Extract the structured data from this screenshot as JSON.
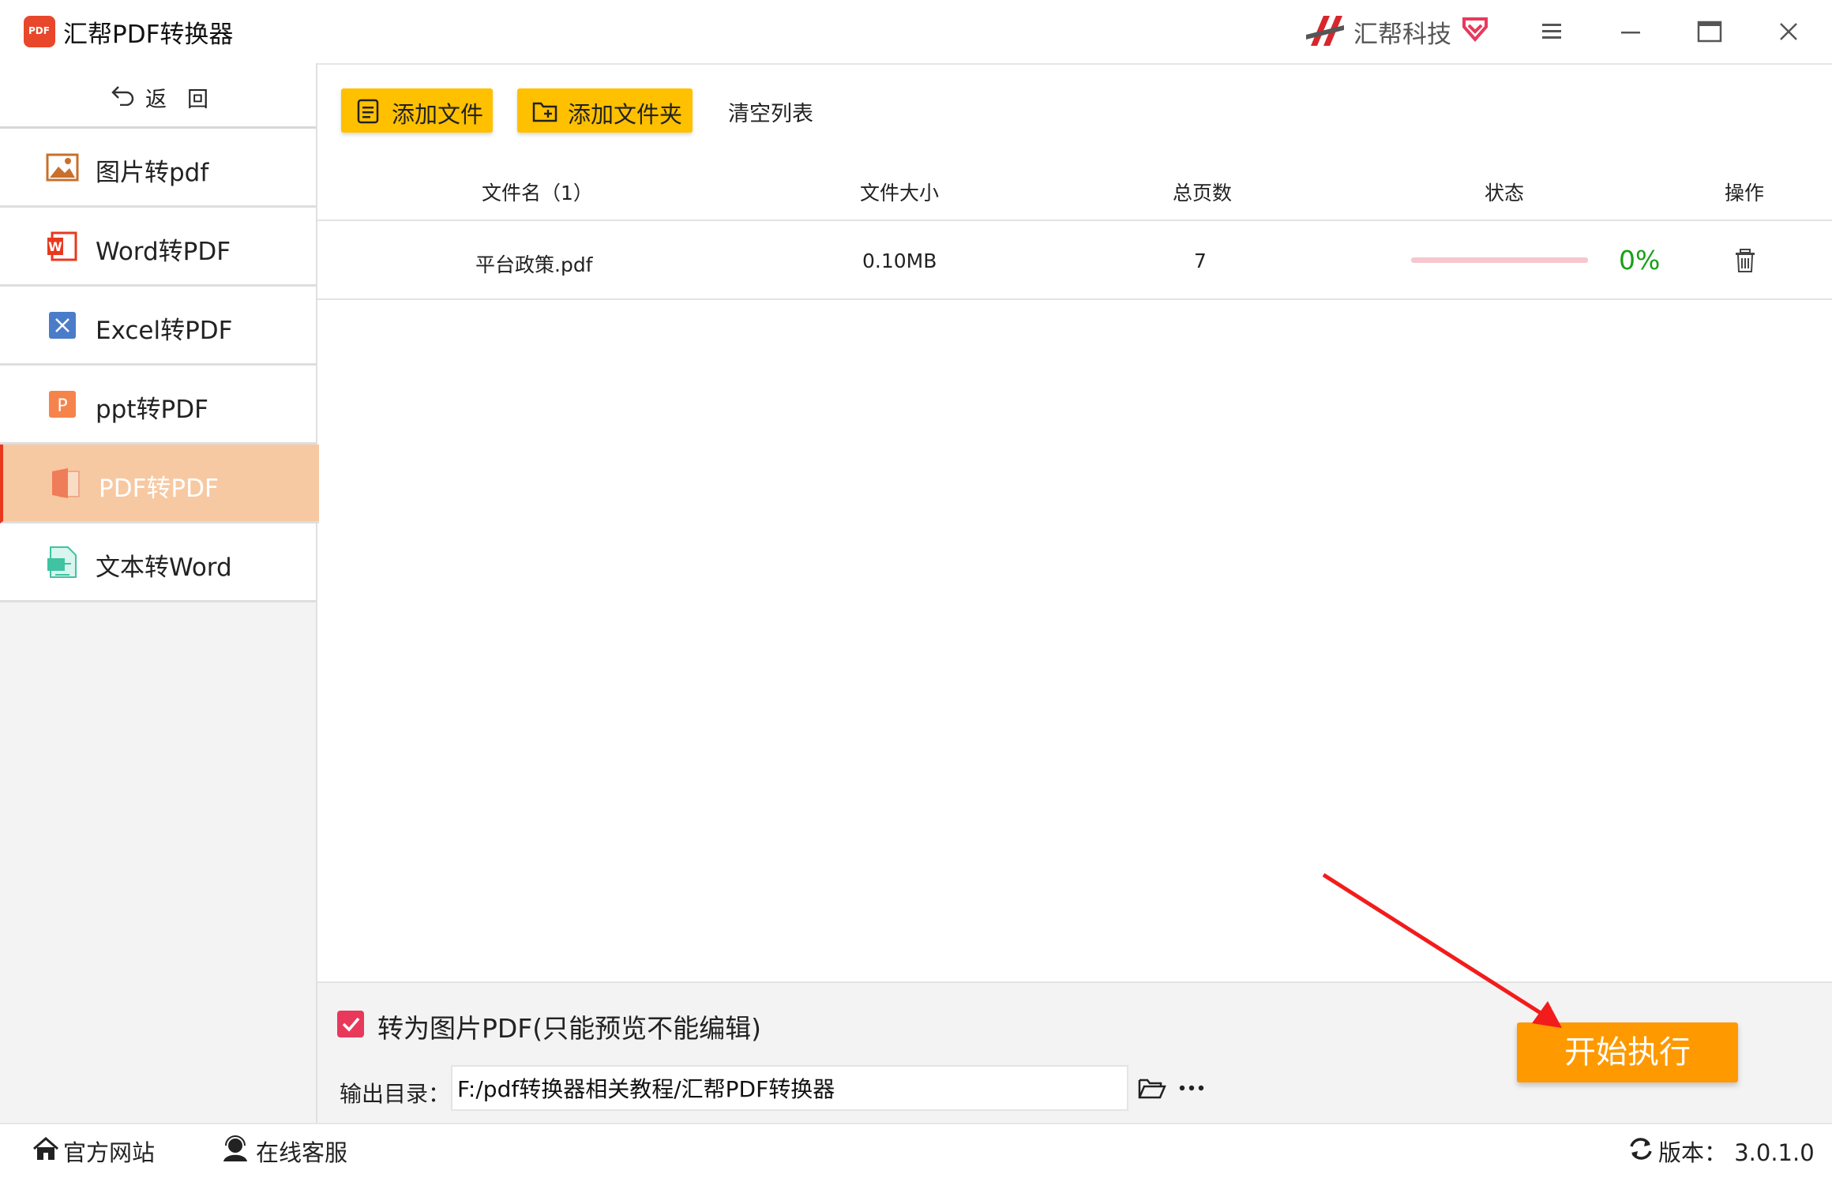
{
  "app": {
    "title": "汇帮PDF转换器",
    "logo_text": "PDF",
    "brand": "汇帮科技"
  },
  "window_controls": [
    "menu-icon",
    "minimize-icon",
    "maximize-icon",
    "close-icon"
  ],
  "sidebar": {
    "back_label": "返回",
    "items": [
      {
        "label": "图片转pdf",
        "icon": "image-icon",
        "active": false
      },
      {
        "label": "Word转PDF",
        "icon": "word-icon",
        "active": false
      },
      {
        "label": "Excel转PDF",
        "icon": "excel-icon",
        "active": false
      },
      {
        "label": "ppt转PDF",
        "icon": "ppt-icon",
        "active": false
      },
      {
        "label": "PDF转PDF",
        "icon": "pdf-icon",
        "active": true
      },
      {
        "label": "文本转Word",
        "icon": "text-file-icon",
        "active": false
      }
    ]
  },
  "toolbar": {
    "add_file": "添加文件",
    "add_folder": "添加文件夹",
    "clear_list": "清空列表"
  },
  "table": {
    "headers": {
      "filename": "文件名（1）",
      "size": "文件大小",
      "pages": "总页数",
      "status": "状态",
      "action": "操作"
    },
    "rows": [
      {
        "filename": "平台政策.pdf",
        "size": "0.10MB",
        "pages": "7",
        "progress": 0,
        "progress_text": "0%"
      }
    ]
  },
  "options": {
    "convert_to_image_pdf": "转为图片PDF(只能预览不能编辑)",
    "convert_checked": true,
    "output_label": "输出目录：",
    "output_path": "F:/pdf转换器相关教程/汇帮PDF转换器",
    "start_button": "开始执行"
  },
  "statusbar": {
    "website": "官方网站",
    "support": "在线客服",
    "version": "版本：  3.0.1.0"
  },
  "colors": {
    "accent_yellow": "#ffc000",
    "start_orange": "#ff9900",
    "active_item": "#f7c9a2",
    "checkbox": "#e8395b",
    "progress_text": "#17a017"
  }
}
